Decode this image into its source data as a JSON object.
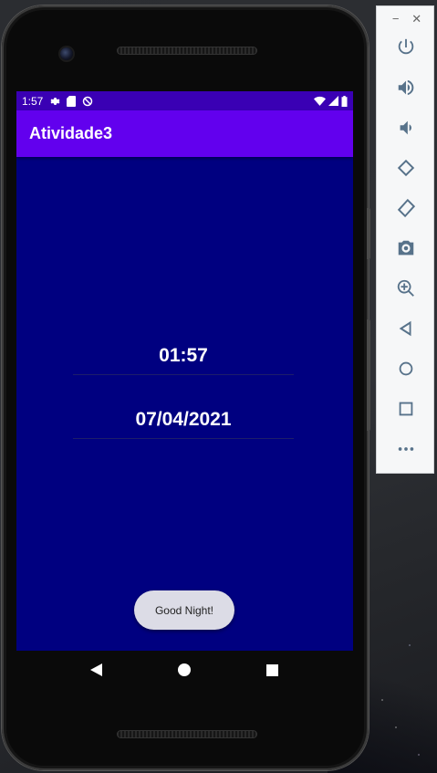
{
  "statusbar": {
    "time": "1:57"
  },
  "app": {
    "title": "Atividade3",
    "time_value": "01:57",
    "date_value": "07/04/2021",
    "toast": "Good Night!"
  },
  "colors": {
    "screen_background": "#000080",
    "app_bar": "#6200ee",
    "status_bar": "#3a00b4",
    "toast_background": "#dcdce6"
  },
  "emulator_toolbar": {
    "window_controls": [
      "minimize-icon",
      "close-icon"
    ],
    "buttons": [
      "power-icon",
      "volume-up-icon",
      "volume-down-icon",
      "rotate-left-icon",
      "rotate-right-icon",
      "camera-icon",
      "zoom-icon",
      "back-icon",
      "home-icon",
      "overview-icon",
      "more-icon"
    ]
  }
}
